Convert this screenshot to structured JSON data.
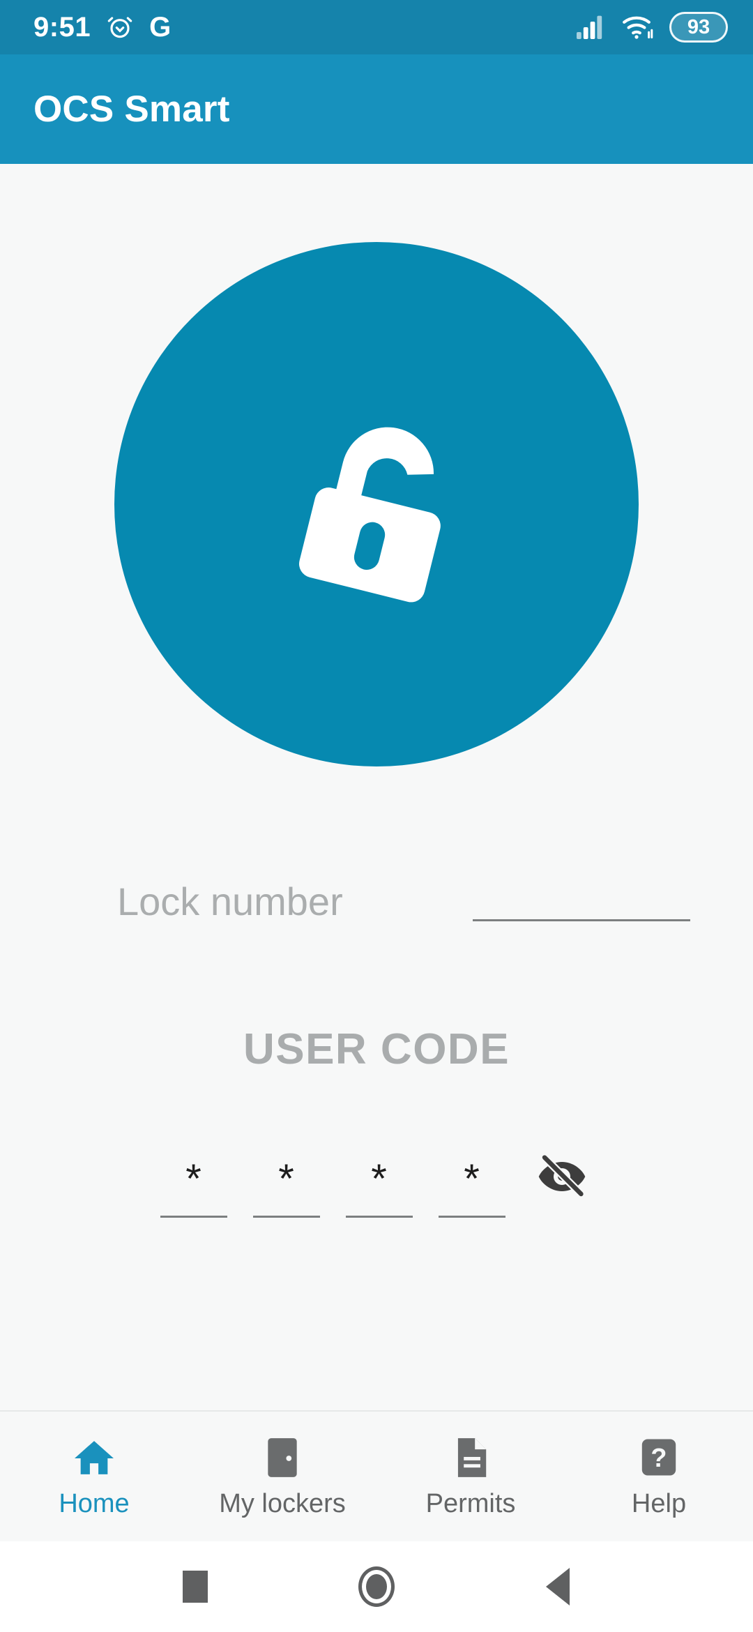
{
  "status_bar": {
    "time": "9:51",
    "alarm_icon": "alarm-clock-icon",
    "google_icon": "G",
    "signal_icon": "cellular-signal-icon",
    "wifi_icon": "wifi-icon",
    "battery_level": "93",
    "background_color": "#1583ab"
  },
  "app_bar": {
    "title": "OCS Smart",
    "background_color": "#1791bd",
    "text_color": "#ffffff"
  },
  "main": {
    "hero": {
      "icon": "open-padlock-icon",
      "circle_color": "#0689b0",
      "icon_color": "#ffffff"
    },
    "lock_number": {
      "label": "Lock number",
      "value": "",
      "placeholder": ""
    },
    "user_code": {
      "title": "USER CODE",
      "digits": [
        "*",
        "*",
        "*",
        "*"
      ],
      "visibility_icon": "eye-off-icon",
      "masked": true
    }
  },
  "bottom_nav": {
    "active_color": "#1a91bd",
    "inactive_color": "#636566",
    "items": [
      {
        "label": "Home",
        "icon": "home-icon",
        "active": true
      },
      {
        "label": "My lockers",
        "icon": "door-icon",
        "active": false
      },
      {
        "label": "Permits",
        "icon": "document-icon",
        "active": false
      },
      {
        "label": "Help",
        "icon": "question-mark-icon",
        "active": false
      }
    ]
  },
  "android_nav": {
    "recents_icon": "square-recents-icon",
    "home_icon": "circle-home-icon",
    "back_icon": "triangle-back-icon"
  }
}
